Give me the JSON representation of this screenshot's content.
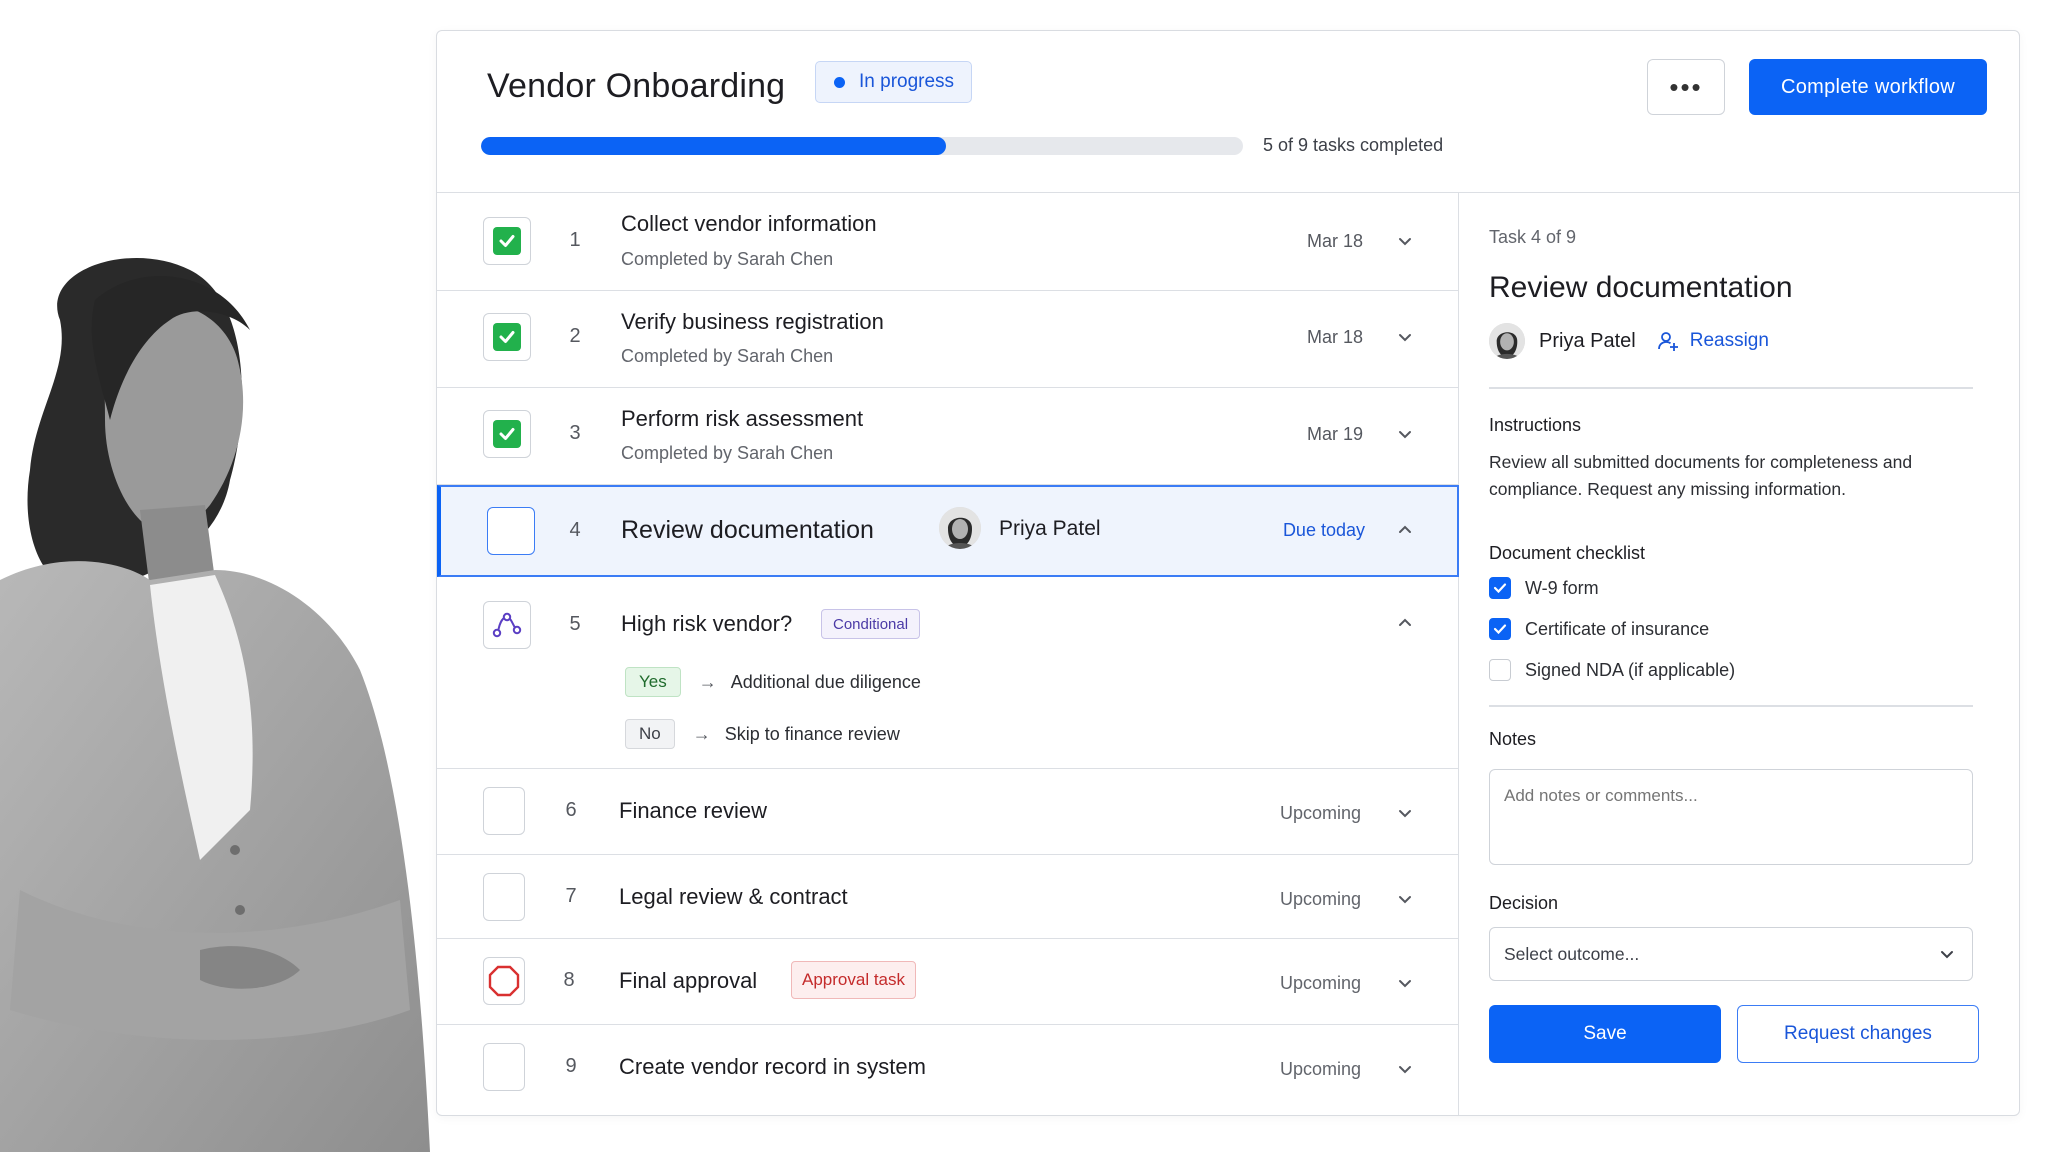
{
  "header": {
    "title": "Vendor Onboarding",
    "status": "In progress",
    "more_label": "•••",
    "complete_label": "Complete workflow",
    "progress_fraction": 0.61,
    "progress_text": "5 of 9 tasks completed"
  },
  "tasks": [
    {
      "num": "1",
      "name": "Collect vendor information",
      "sub": "Completed by Sarah Chen",
      "date": "Mar 18"
    },
    {
      "num": "2",
      "name": "Verify business registration",
      "sub": "Completed by Sarah Chen",
      "date": "Mar 18"
    },
    {
      "num": "3",
      "name": "Perform risk assessment",
      "sub": "Completed by Sarah Chen",
      "date": "Mar 19"
    },
    {
      "num": "4",
      "name": "Review documentation",
      "assignee": "Priya Patel",
      "due": "Due today"
    },
    {
      "num": "5",
      "name": "High risk vendor?",
      "badge": "Conditional",
      "branches": [
        {
          "option": "Yes",
          "arrow": "→",
          "result": "Additional due diligence"
        },
        {
          "option": "No",
          "arrow": "→",
          "result": "Skip to finance review"
        }
      ]
    },
    {
      "num": "6",
      "name": "Finance review",
      "status": "Upcoming"
    },
    {
      "num": "7",
      "name": "Legal review & contract",
      "status": "Upcoming"
    },
    {
      "num": "8",
      "name": "Final approval",
      "badge": "Approval task",
      "status": "Upcoming"
    },
    {
      "num": "9",
      "name": "Create vendor record in system",
      "status": "Upcoming"
    }
  ],
  "panel": {
    "task_count": "Task 4 of 9",
    "title": "Review documentation",
    "assignee": "Priya Patel",
    "reassign": "Reassign",
    "instructions_label": "Instructions",
    "instructions": "Review all submitted documents for completeness and compliance. Request any missing information.",
    "checklist_label": "Document checklist",
    "checklist": [
      {
        "label": "W-9 form",
        "checked": true
      },
      {
        "label": "Certificate of insurance",
        "checked": true
      },
      {
        "label": "Signed NDA (if applicable)",
        "checked": false
      }
    ],
    "notes_label": "Notes",
    "notes_placeholder": "Add notes or comments...",
    "decision_label": "Decision",
    "decision_value": "Select outcome...",
    "save_label": "Save",
    "request_label": "Request changes"
  },
  "colors": {
    "accent": "#0b63f5",
    "success": "#22b14c",
    "danger": "#d93030",
    "conditional": "#4b3aa6"
  }
}
